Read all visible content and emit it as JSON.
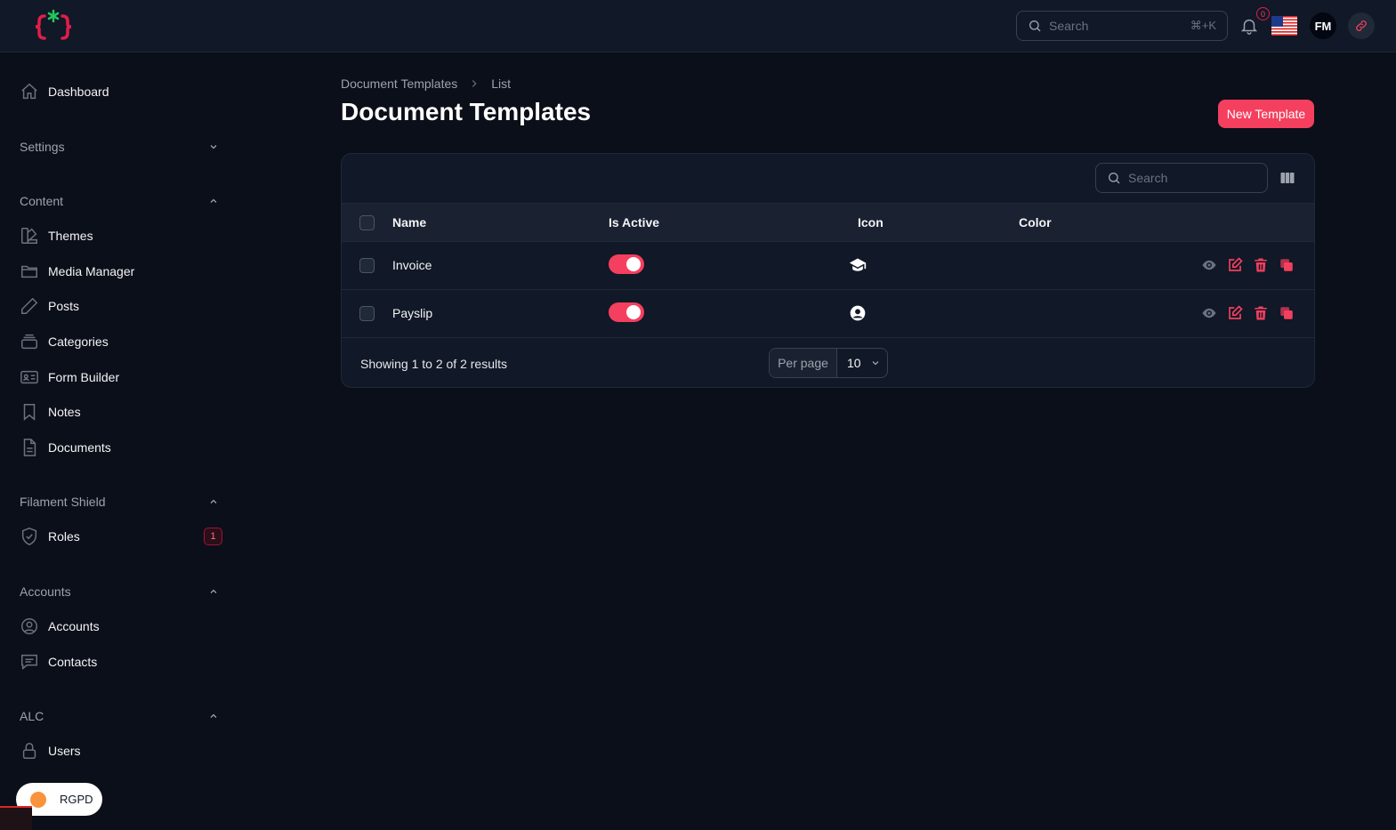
{
  "topbar": {
    "logo": "brackets-star-logo",
    "search": {
      "placeholder": "Search",
      "shortcut": "⌘+K"
    },
    "notifications": {
      "count": "0"
    },
    "locale_flag": "us-flag",
    "avatar_initials": "FM"
  },
  "sidebar": {
    "dashboard": "Dashboard",
    "settings": "Settings",
    "content": {
      "label": "Content",
      "items": [
        "Themes",
        "Media Manager",
        "Posts",
        "Categories",
        "Form Builder",
        "Notes",
        "Documents"
      ]
    },
    "shield": {
      "label": "Filament Shield",
      "roles": "Roles",
      "roles_badge": "1"
    },
    "accounts": {
      "label": "Accounts",
      "items": [
        "Accounts",
        "Contacts"
      ]
    },
    "alc": {
      "label": "ALC",
      "items": [
        "Users"
      ]
    },
    "rgpd": "RGPD"
  },
  "main": {
    "breadcrumb": [
      "Document Templates",
      "List"
    ],
    "title": "Document Templates",
    "new_button": "New Template",
    "table": {
      "search_placeholder": "Search",
      "columns": [
        "Name",
        "Is Active",
        "Icon",
        "Color"
      ],
      "rows": [
        {
          "name": "Invoice",
          "is_active": true,
          "icon": "graduation-cap-icon",
          "color": ""
        },
        {
          "name": "Payslip",
          "is_active": true,
          "icon": "user-circle-icon",
          "color": ""
        }
      ],
      "showing": "Showing 1 to 2 of 2 results",
      "per_page_label": "Per page",
      "per_page_value": "10"
    }
  },
  "colors": {
    "accent": "#f43f5e",
    "background": "#0b0f19",
    "surface": "#111827"
  }
}
